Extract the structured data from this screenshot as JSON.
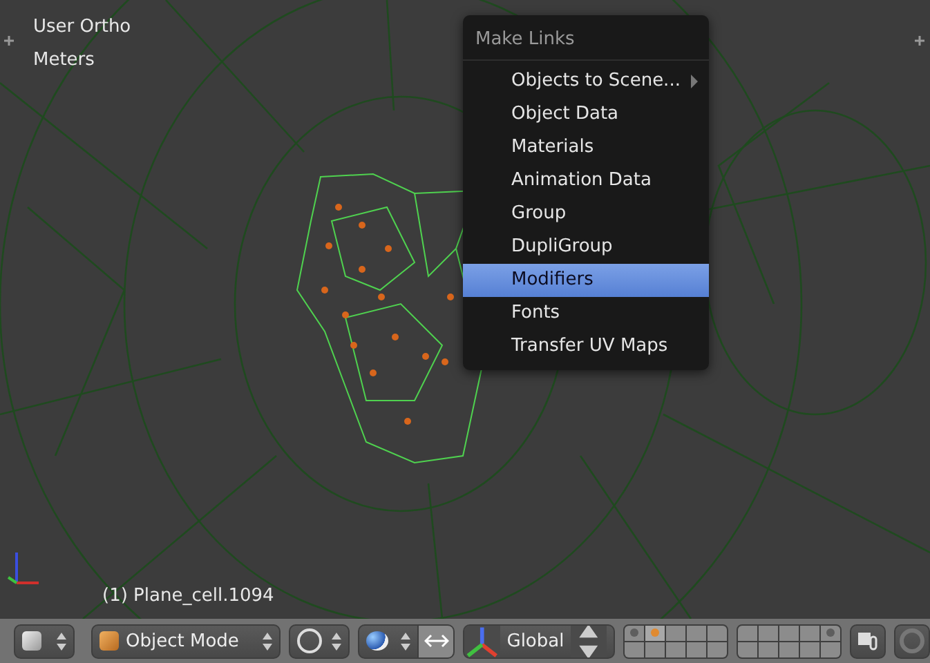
{
  "viewport": {
    "view_name": "User Ortho",
    "units": "Meters",
    "object_info": "(1) Plane_cell.1094"
  },
  "menu": {
    "title": "Make Links",
    "items": [
      {
        "label": "Objects to Scene...",
        "selected": false,
        "submenu": true
      },
      {
        "label": "Object Data",
        "selected": false,
        "submenu": false
      },
      {
        "label": "Materials",
        "selected": false,
        "submenu": false
      },
      {
        "label": "Animation Data",
        "selected": false,
        "submenu": false
      },
      {
        "label": "Group",
        "selected": false,
        "submenu": false
      },
      {
        "label": "DupliGroup",
        "selected": false,
        "submenu": false
      },
      {
        "label": "Modifiers",
        "selected": true,
        "submenu": false
      },
      {
        "label": "Fonts",
        "selected": false,
        "submenu": false
      },
      {
        "label": "Transfer UV Maps",
        "selected": false,
        "submenu": false
      }
    ]
  },
  "header": {
    "mode": "Object Mode",
    "orientation": "Global",
    "layer_blocks": [
      {
        "layers": [
          {
            "objects": true,
            "selected": false
          },
          {
            "objects": true,
            "selected": true
          },
          {
            "objects": false,
            "selected": false
          },
          {
            "objects": false,
            "selected": false
          },
          {
            "objects": false,
            "selected": false
          },
          {
            "objects": false,
            "selected": false
          },
          {
            "objects": false,
            "selected": false
          },
          {
            "objects": false,
            "selected": false
          },
          {
            "objects": false,
            "selected": false
          },
          {
            "objects": false,
            "selected": false
          }
        ]
      },
      {
        "layers": [
          {
            "objects": false,
            "selected": false
          },
          {
            "objects": false,
            "selected": false
          },
          {
            "objects": false,
            "selected": false
          },
          {
            "objects": false,
            "selected": false
          },
          {
            "objects": true,
            "selected": false
          },
          {
            "objects": false,
            "selected": false
          },
          {
            "objects": false,
            "selected": false
          },
          {
            "objects": false,
            "selected": false
          },
          {
            "objects": false,
            "selected": false
          },
          {
            "objects": false,
            "selected": false
          }
        ]
      }
    ]
  }
}
